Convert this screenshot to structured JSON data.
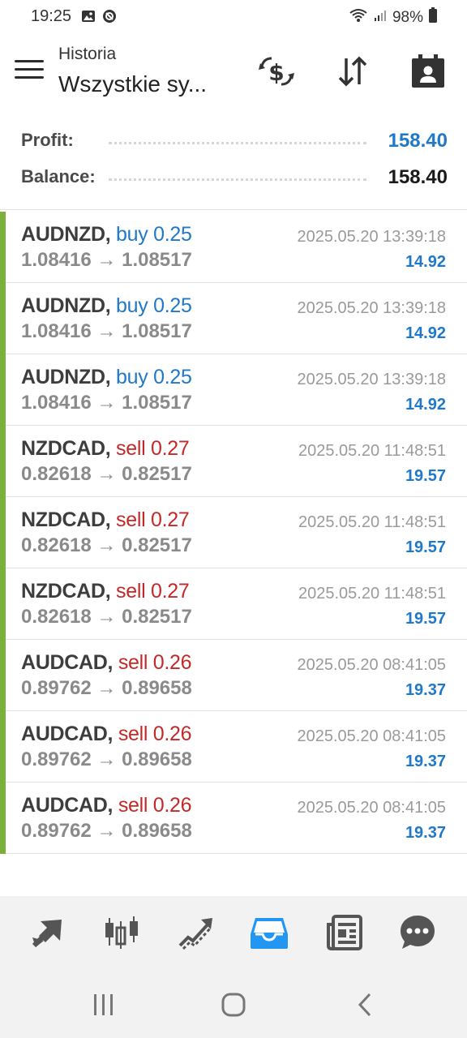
{
  "status_bar": {
    "time": "19:25",
    "battery": "98%",
    "icons": [
      "image-icon",
      "dnd-icon",
      "wifi-icon",
      "signal-icon",
      "battery-icon"
    ]
  },
  "app_bar": {
    "subtitle": "Historia",
    "title": "Wszystkie sy...",
    "icons": [
      "menu-icon",
      "currency-exchange-icon",
      "sort-icon",
      "calendar-person-icon"
    ]
  },
  "summary": {
    "profit_label": "Profit:",
    "profit_value": "158.40",
    "balance_label": "Balance:",
    "balance_value": "158.40"
  },
  "colors": {
    "accent_blue": "#1f78c8",
    "sell_red": "#c62828",
    "deal_bar_green": "#79b13a"
  },
  "deals": [
    {
      "symbol": "AUDNZD,",
      "side": "buy 0.25",
      "prices": "1.08416 → 1.08517",
      "time": "2025.05.20 13:39:18",
      "profit": "14.92"
    },
    {
      "symbol": "AUDNZD,",
      "side": "buy 0.25",
      "prices": "1.08416 → 1.08517",
      "time": "2025.05.20 13:39:18",
      "profit": "14.92"
    },
    {
      "symbol": "AUDNZD,",
      "side": "buy 0.25",
      "prices": "1.08416 → 1.08517",
      "time": "2025.05.20 13:39:18",
      "profit": "14.92"
    },
    {
      "symbol": "NZDCAD,",
      "side": "sell 0.27",
      "prices": "0.82618 → 0.82517",
      "time": "2025.05.20 11:48:51",
      "profit": "19.57"
    },
    {
      "symbol": "NZDCAD,",
      "side": "sell 0.27",
      "prices": "0.82618 → 0.82517",
      "time": "2025.05.20 11:48:51",
      "profit": "19.57"
    },
    {
      "symbol": "NZDCAD,",
      "side": "sell 0.27",
      "prices": "0.82618 → 0.82517",
      "time": "2025.05.20 11:48:51",
      "profit": "19.57"
    },
    {
      "symbol": "AUDCAD,",
      "side": "sell 0.26",
      "prices": "0.89762 → 0.89658",
      "time": "2025.05.20 08:41:05",
      "profit": "19.37"
    },
    {
      "symbol": "AUDCAD,",
      "side": "sell 0.26",
      "prices": "0.89762 → 0.89658",
      "time": "2025.05.20 08:41:05",
      "profit": "19.37"
    },
    {
      "symbol": "AUDCAD,",
      "side": "sell 0.26",
      "prices": "0.89762 → 0.89658",
      "time": "2025.05.20 08:41:05",
      "profit": "19.37"
    }
  ],
  "bottom_nav": {
    "items": [
      "quotes-icon",
      "chart-icon",
      "trade-icon",
      "history-icon",
      "news-icon",
      "messages-icon"
    ],
    "active": "history-icon"
  },
  "system_nav": [
    "recents-icon",
    "home-icon",
    "back-icon"
  ]
}
